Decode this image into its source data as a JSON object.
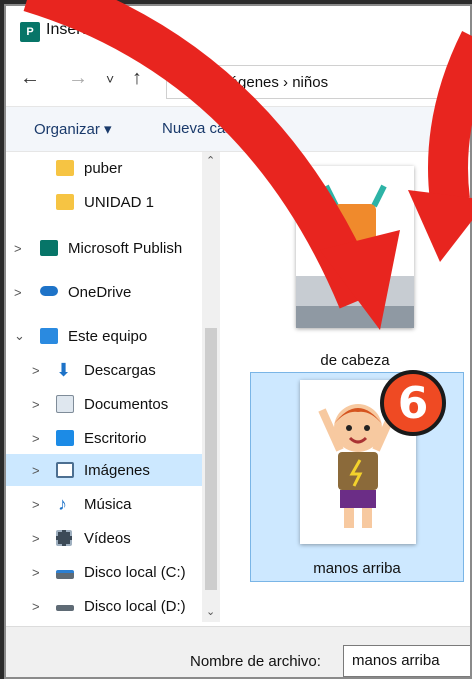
{
  "window": {
    "title": "Insertar imagen",
    "app_icon": "P"
  },
  "nav": {
    "back": "←",
    "forward": "→",
    "recent": "˅",
    "up": "↑",
    "address": "Imágenes › niños"
  },
  "commandbar": {
    "organize": "Organizar ▾",
    "new_folder": "Nueva carpeta"
  },
  "sidebar": {
    "items": [
      {
        "label": "puber",
        "icon": "folder-icon",
        "chevron": ""
      },
      {
        "label": "UNIDAD 1",
        "icon": "folder-icon",
        "chevron": ""
      },
      {
        "label": "Microsoft Publish",
        "icon": "publisher-icon",
        "chevron": ">"
      },
      {
        "label": "OneDrive",
        "icon": "cloud-icon",
        "chevron": ">"
      },
      {
        "label": "Este equipo",
        "icon": "pc-icon",
        "chevron": "⌄"
      },
      {
        "label": "Descargas",
        "icon": "download-icon",
        "chevron": ">"
      },
      {
        "label": "Documentos",
        "icon": "documents-icon",
        "chevron": ">"
      },
      {
        "label": "Escritorio",
        "icon": "desktop-icon",
        "chevron": ">"
      },
      {
        "label": "Imágenes",
        "icon": "pictures-icon",
        "chevron": ">"
      },
      {
        "label": "Música",
        "icon": "music-icon",
        "chevron": ">"
      },
      {
        "label": "Vídeos",
        "icon": "videos-icon",
        "chevron": ">"
      },
      {
        "label": "Disco local (C:)",
        "icon": "drive-icon",
        "chevron": ">"
      },
      {
        "label": "Disco local (D:)",
        "icon": "drive-icon",
        "chevron": ">"
      }
    ]
  },
  "files": [
    {
      "name": "de cabeza",
      "selected": false
    },
    {
      "name": "manos arriba",
      "selected": true
    }
  ],
  "footer": {
    "filename_label": "Nombre de archivo:",
    "filename_value": "manos arriba"
  },
  "annotation": {
    "step": "6"
  },
  "colors": {
    "arrow": "#e8251f",
    "badge": "#ef4a23",
    "selection": "#cce8ff"
  }
}
